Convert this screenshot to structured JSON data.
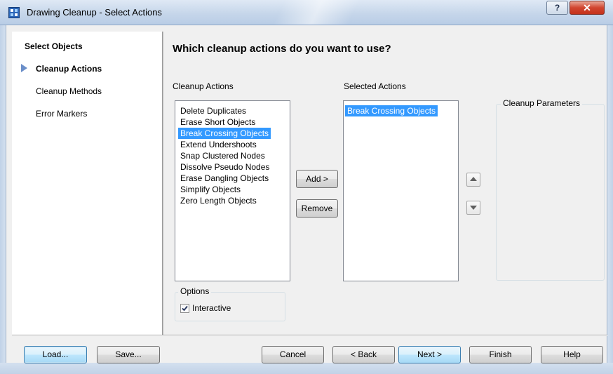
{
  "window": {
    "title": "Drawing Cleanup - Select Actions",
    "help_label": "?",
    "close_label": "✕"
  },
  "nav": {
    "items": [
      {
        "label": "Select Objects",
        "bold": true
      },
      {
        "label": "Cleanup Actions",
        "bold": true,
        "current": true
      },
      {
        "label": "Cleanup Methods",
        "bold": false
      },
      {
        "label": "Error Markers",
        "bold": false
      }
    ]
  },
  "main": {
    "heading": "Which cleanup actions do you want to use?",
    "actions_label": "Cleanup Actions",
    "selected_label": "Selected Actions",
    "parameters_label": "Cleanup Parameters",
    "actions": [
      "Delete Duplicates",
      "Erase Short Objects",
      "Break Crossing Objects",
      "Extend Undershoots",
      "Snap Clustered Nodes",
      "Dissolve Pseudo Nodes",
      "Erase Dangling Objects",
      "Simplify Objects",
      "Zero Length Objects"
    ],
    "highlighted_action": "Break Crossing Objects",
    "selected_actions": [
      "Break Crossing Objects"
    ],
    "add_label": "Add >",
    "remove_label": "Remove",
    "options": {
      "title": "Options",
      "interactive_label": "Interactive",
      "interactive_checked": true
    }
  },
  "footer": {
    "load_label": "Load...",
    "save_label": "Save...",
    "cancel_label": "Cancel",
    "back_label": "< Back",
    "next_label": "Next >",
    "finish_label": "Finish",
    "help_label": "Help"
  }
}
